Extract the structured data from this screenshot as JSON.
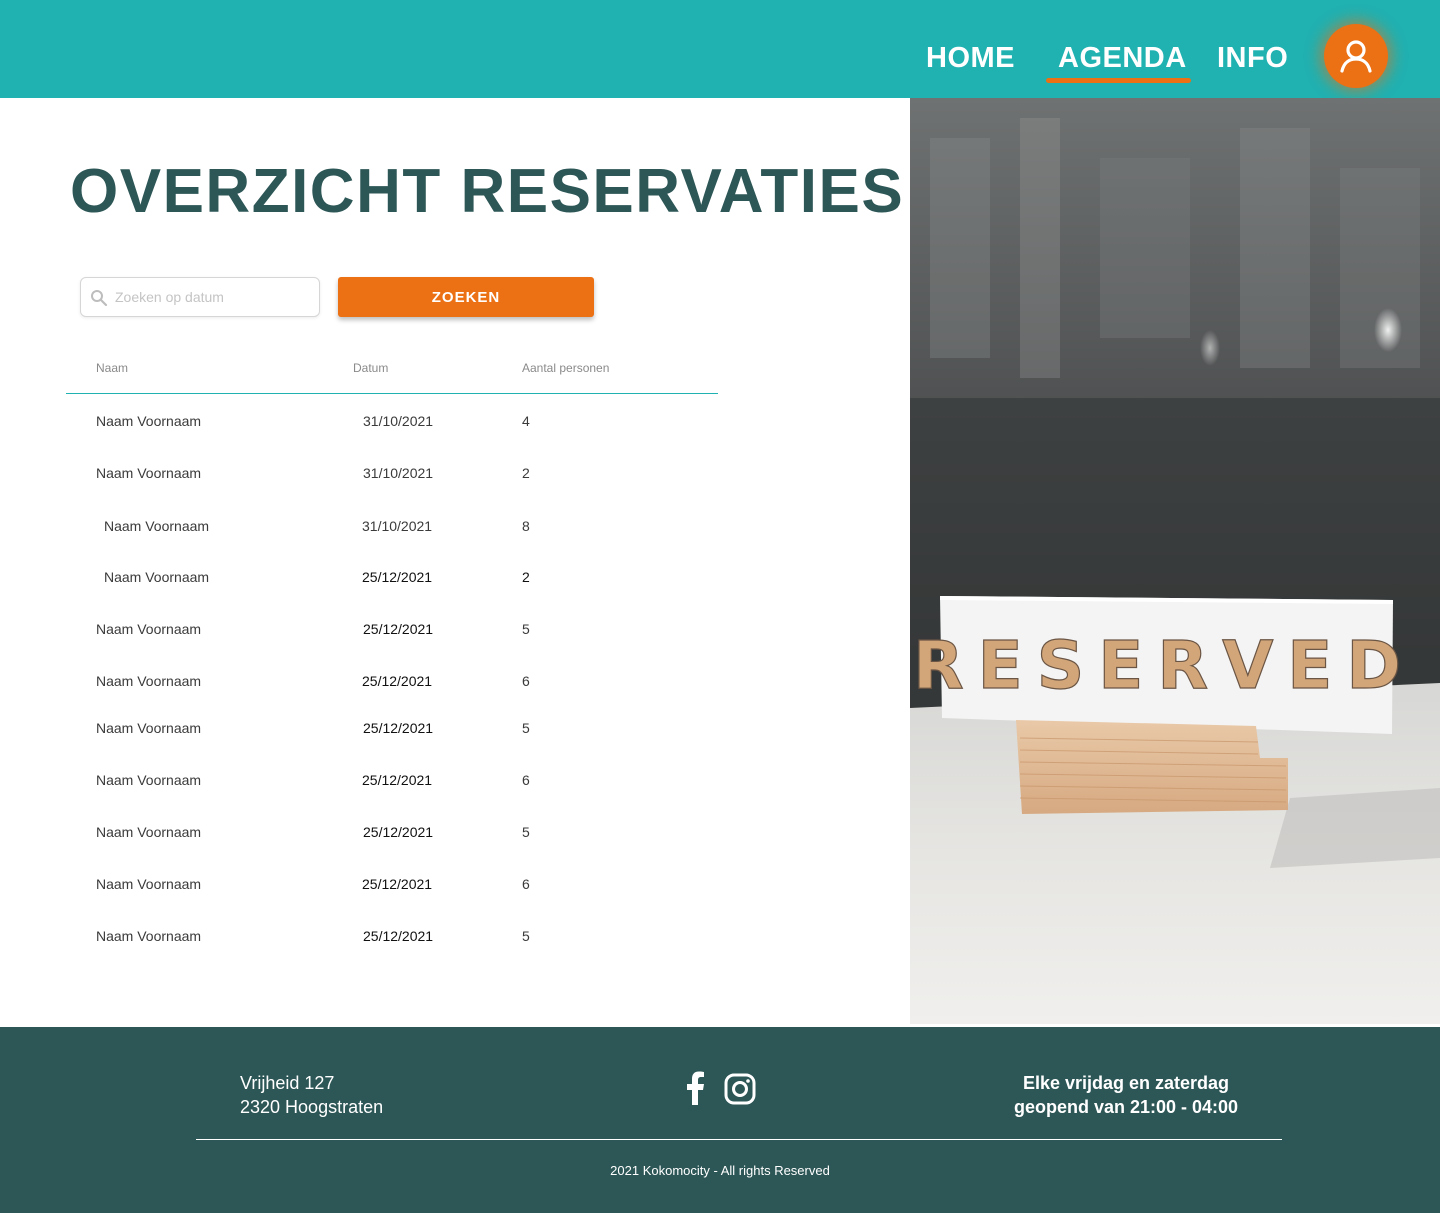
{
  "nav": {
    "home": "HOME",
    "agenda": "AGENDA",
    "info": "INFO",
    "active": "AGENDA",
    "user_icon": "user-icon"
  },
  "main": {
    "title": "OVERZICHT RESERVATIES",
    "search": {
      "placeholder": "Zoeken op datum",
      "value": "",
      "button_label": "ZOEKEN"
    },
    "table": {
      "headers": [
        "Naam",
        "Datum",
        "Aantal personen"
      ],
      "rows": [
        {
          "name": "Naam Voornaam",
          "date": "31/10/2021",
          "count": "4"
        },
        {
          "name": "Naam Voornaam",
          "date": "31/10/2021",
          "count": "2"
        },
        {
          "name": "Naam Voornaam",
          "date": "31/10/2021",
          "count": "8"
        },
        {
          "name": "Naam Voornaam",
          "date": "25/12/2021",
          "count": "2"
        },
        {
          "name": "Naam Voornaam",
          "date": "25/12/2021",
          "count": "5"
        },
        {
          "name": "Naam Voornaam",
          "date": "25/12/2021",
          "count": "6"
        },
        {
          "name": "Naam Voornaam",
          "date": "25/12/2021",
          "count": "5"
        },
        {
          "name": "Naam Voornaam",
          "date": "25/12/2021",
          "count": "6"
        },
        {
          "name": "Naam Voornaam",
          "date": "25/12/2021",
          "count": "5"
        },
        {
          "name": "Naam Voornaam",
          "date": "25/12/2021",
          "count": "6"
        },
        {
          "name": "Naam Voornaam",
          "date": "25/12/2021",
          "count": "5"
        }
      ]
    }
  },
  "hero": {
    "sign_text": "RESERVED"
  },
  "footer": {
    "address_line1": "Vrijheid 127",
    "address_line2": "2320 Hoogstraten",
    "social_icons": [
      "facebook-icon",
      "instagram-icon"
    ],
    "hours_line1": "Elke vrijdag en zaterdag",
    "hours_line2": "geopend van 21:00 - 04:00",
    "copyright": "2021 Kokomocity - All rights Reserved"
  },
  "colors": {
    "header": "#20b1b1",
    "accent": "#ec7014",
    "title": "#2d5656",
    "footer": "#2d5656"
  }
}
